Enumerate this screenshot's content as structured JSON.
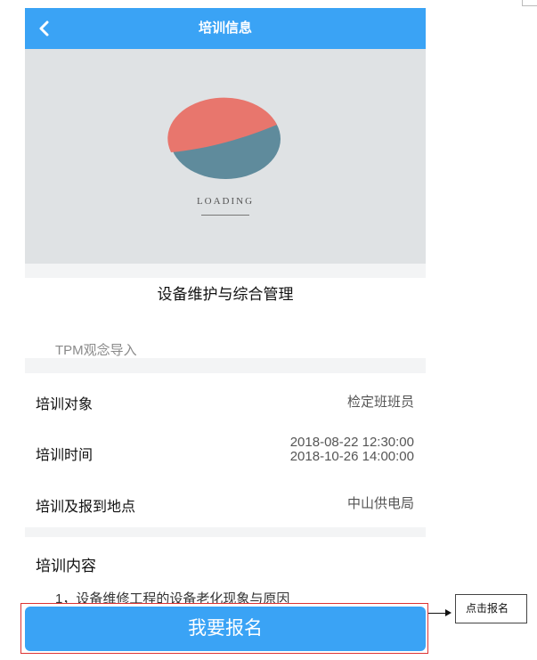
{
  "header": {
    "title": "培训信息",
    "back_icon": "chevron-left-icon"
  },
  "banner": {
    "loading_text": "LOADING"
  },
  "course": {
    "title": "设备维护与综合管理",
    "subtitle": "TPM观念导入"
  },
  "details": {
    "target_label": "培训对象",
    "target_value": "检定班班员",
    "time_label": "培训时间",
    "time_start": "2018-08-22 12:30:00",
    "time_end": "2018-10-26 14:00:00",
    "location_label": "培训及报到地点",
    "location_value": "中山供电局"
  },
  "content": {
    "heading": "培训内容",
    "items": [
      "1，设备维修工程的设备老化现象与原因"
    ]
  },
  "action": {
    "signup_label": "我要报名"
  },
  "annotation": {
    "callout_text": "点击报名"
  },
  "colors": {
    "primary": "#3aa3f5",
    "pie_red": "#e8766d",
    "pie_blue": "#5f8b9c",
    "highlight": "#dd3333"
  }
}
